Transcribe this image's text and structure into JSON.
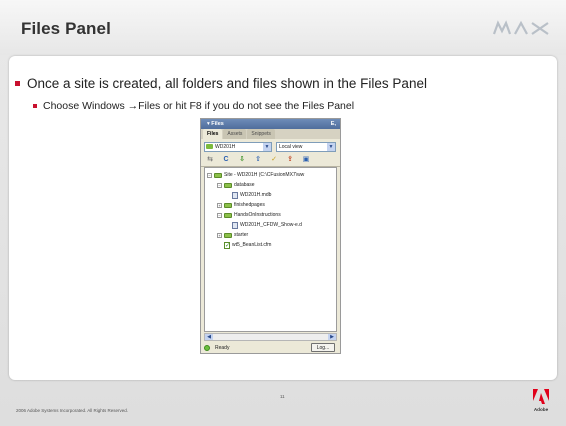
{
  "slide": {
    "title": "Files Panel",
    "bullets": [
      "Once a site is created, all folders and files shown in the Files Panel"
    ],
    "sub_bullets": [
      "Choose Windows →Files or hit F8 if you do not see the Files Panel"
    ],
    "logo_text": "MAX",
    "page_number": "11",
    "copyright": "2006 Adobe Systems Incorporated.  All Rights Reserved.",
    "brand": "Adobe"
  },
  "files_panel": {
    "title": "▾ Files",
    "menu_glyph": "E,",
    "tabs": [
      {
        "label": "Files",
        "active": true
      },
      {
        "label": "Assets",
        "active": false
      },
      {
        "label": "Snippets",
        "active": false
      }
    ],
    "site_select": "WD201H",
    "view_select": "Local view",
    "tree": [
      {
        "label": "Site - WD201H (C:\\CFusionMX7\\ww",
        "level": 0,
        "type": "folder",
        "exp": "−"
      },
      {
        "label": "database",
        "level": 1,
        "type": "folder",
        "exp": "−"
      },
      {
        "label": "WD201H.mdb",
        "level": 2,
        "type": "file",
        "exp": ""
      },
      {
        "label": "finishedpages",
        "level": 1,
        "type": "folder",
        "exp": "+"
      },
      {
        "label": "HandsOnInstructions",
        "level": 1,
        "type": "folder",
        "exp": "−"
      },
      {
        "label": "WD201H_CFDW_Show-e.d",
        "level": 2,
        "type": "file",
        "exp": ""
      },
      {
        "label": "starter",
        "level": 1,
        "type": "folder",
        "exp": "+"
      },
      {
        "label": "wt5_BeanList.cfm",
        "level": 1,
        "type": "check",
        "exp": ""
      }
    ],
    "status": "Ready",
    "log_button": "Log..."
  },
  "colors": {
    "accent_red": "#c8102e",
    "folder_green": "#8cc04a"
  }
}
